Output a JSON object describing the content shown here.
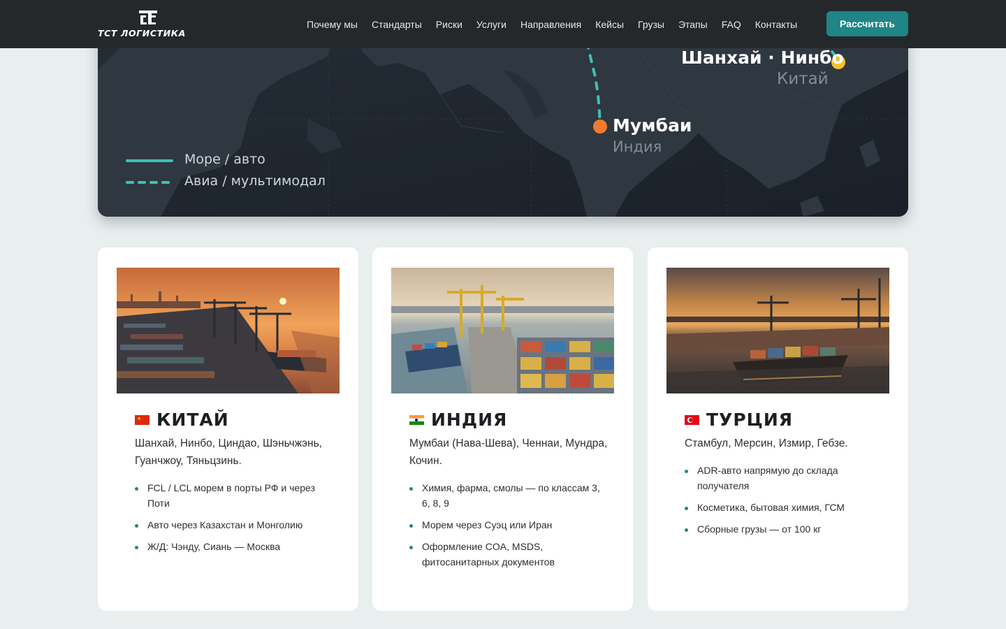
{
  "header": {
    "logo_text": "ТСТ ЛОГИСТИКА",
    "nav": [
      "Почему мы",
      "Стандарты",
      "Риски",
      "Услуги",
      "Направления",
      "Кейсы",
      "Грузы",
      "Этапы",
      "FAQ",
      "Контакты"
    ],
    "cta": "Рассчитать"
  },
  "map": {
    "cities": [
      {
        "name": "Шанхай · Нинбо",
        "country": "Китай",
        "marker_color": "#f2c230"
      },
      {
        "name": "Мумбаи",
        "country": "Индия",
        "marker_color": "#f07c2a"
      }
    ],
    "legend": [
      {
        "label": "Море / авто",
        "style": "solid"
      },
      {
        "label": "Авиа / мультимодал",
        "style": "dashed"
      }
    ],
    "route_color": "#3fc1b4"
  },
  "cards": [
    {
      "country": "КИТАЙ",
      "flag_icon": "china-flag-icon",
      "cities": "Шанхай, Нинбо, Циндао, Шэньчжэнь, Гуанчжоу, Тяньцзинь.",
      "points": [
        "FCL / LCL морем в порты РФ и через Поти",
        "Авто через Казахстан и Монголию",
        "Ж/Д: Чэнду, Сиань — Москва"
      ]
    },
    {
      "country": "ИНДИЯ",
      "flag_icon": "india-flag-icon",
      "cities": "Мумбаи (Нава-Шева), Ченнаи, Мундра, Кочин.",
      "points": [
        "Химия, фарма, смолы — по классам 3, 6, 8, 9",
        "Морем через Суэц или Иран",
        "Оформление COA, MSDS, фитосанитарных документов"
      ]
    },
    {
      "country": "ТУРЦИЯ",
      "flag_icon": "turkey-flag-icon",
      "cities": "Стамбул, Мерсин, Измир, Гебзе.",
      "points": [
        "ADR-авто напрямую до склада получателя",
        "Косметика, бытовая химия, ГСМ",
        "Сборные грузы — от 100 кг"
      ]
    }
  ],
  "colors": {
    "accent": "#1f8587",
    "header_bg": "#25282b",
    "map_bg": "#1e252d"
  }
}
